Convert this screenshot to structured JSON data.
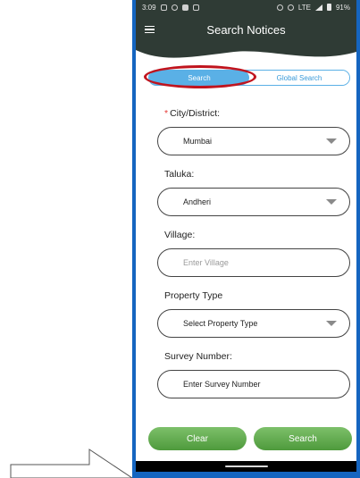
{
  "status_bar": {
    "time": "3:09",
    "network": "LTE",
    "battery": "91%"
  },
  "app_bar": {
    "title": "Search Notices",
    "menu_icon": "hamburger-menu-icon"
  },
  "tabs": [
    {
      "label": "Search",
      "active": true
    },
    {
      "label": "Global Search",
      "active": false
    }
  ],
  "form": {
    "city": {
      "required_mark": "*",
      "label": "City/District:",
      "value": "Mumbai"
    },
    "taluka": {
      "label": "Taluka:",
      "value": "Andheri"
    },
    "village": {
      "label": "Village:",
      "placeholder": "Enter Village"
    },
    "property_type": {
      "label": "Property Type",
      "value": "Select Property Type"
    },
    "survey_number": {
      "label": "Survey Number:",
      "placeholder": "Enter Survey Number"
    }
  },
  "buttons": {
    "clear": "Clear",
    "search": "Search"
  },
  "colors": {
    "header": "#2f3b35",
    "tab_accent": "#5ab0e6",
    "highlight": "#c0141e",
    "button_green": "#5aa64a",
    "frame": "#1565c0"
  }
}
